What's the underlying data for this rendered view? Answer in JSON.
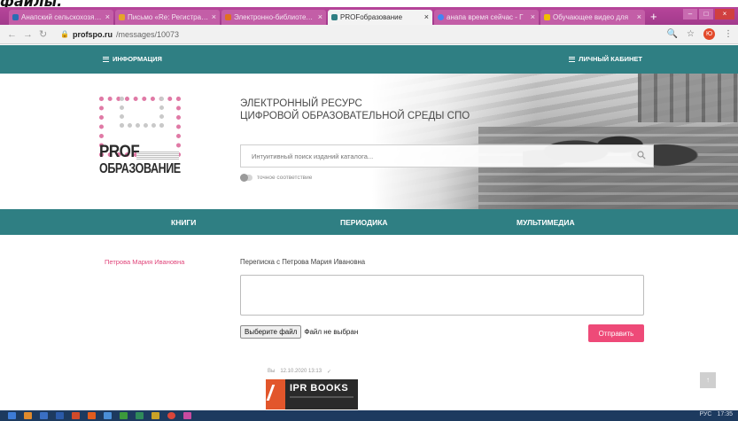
{
  "caption": "файлы.",
  "browser": {
    "tabs": [
      {
        "title": "Анапский сельскохозяйственный",
        "favicon_color": "#2a6db3",
        "active": false
      },
      {
        "title": "Письмо «Re: Регистрация",
        "favicon_color": "#e5a52a",
        "active": false
      },
      {
        "title": "Электронно-библиотечная",
        "favicon_color": "#e07020",
        "active": false
      },
      {
        "title": "PROFобразование",
        "favicon_color": "#2f7f83",
        "active": true
      },
      {
        "title": "анапа время сейчас - Г",
        "favicon_color": "#4285f4",
        "active": false
      },
      {
        "title": "Обучающее видео для",
        "favicon_color": "#f0c000",
        "active": false
      }
    ],
    "new_tab": "+",
    "url_host": "profspo.ru",
    "url_path": "/messages/10073",
    "profile_letter": "Ю"
  },
  "top_nav": {
    "left_label": "ИНФОРМАЦИЯ",
    "right_label": "ЛИЧНЫЙ КАБИНЕТ"
  },
  "hero": {
    "logo_line1": "PROF",
    "logo_line2": "ОБРАЗОВАНИЕ",
    "tagline_line1": "ЭЛЕКТРОННЫЙ РЕСУРС",
    "tagline_line2": "ЦИФРОВОЙ ОБРАЗОВАТЕЛЬНОЙ СРЕДЫ СПО",
    "search_placeholder": "Интуитивный поиск изданий каталога...",
    "exact_match_label": "точное соответствие"
  },
  "main_nav": {
    "books": "КНИГИ",
    "periodicals": "ПЕРИОДИКА",
    "multimedia": "МУЛЬТИМЕДИА"
  },
  "messages": {
    "sidebar_user": "Петрова Мария Ивановна",
    "thread_title": "Переписка с Петрова Мария Ивановна",
    "choose_file": "Выберите файл",
    "no_file": "Файл не выбран",
    "send": "Отправить",
    "last_message_author": "Вы",
    "last_message_time": "12.10.2020 13:13",
    "attachment_logo_text": "IPR BOOKS"
  },
  "taskbar": {
    "lang": "РУС",
    "time": "17:35"
  }
}
